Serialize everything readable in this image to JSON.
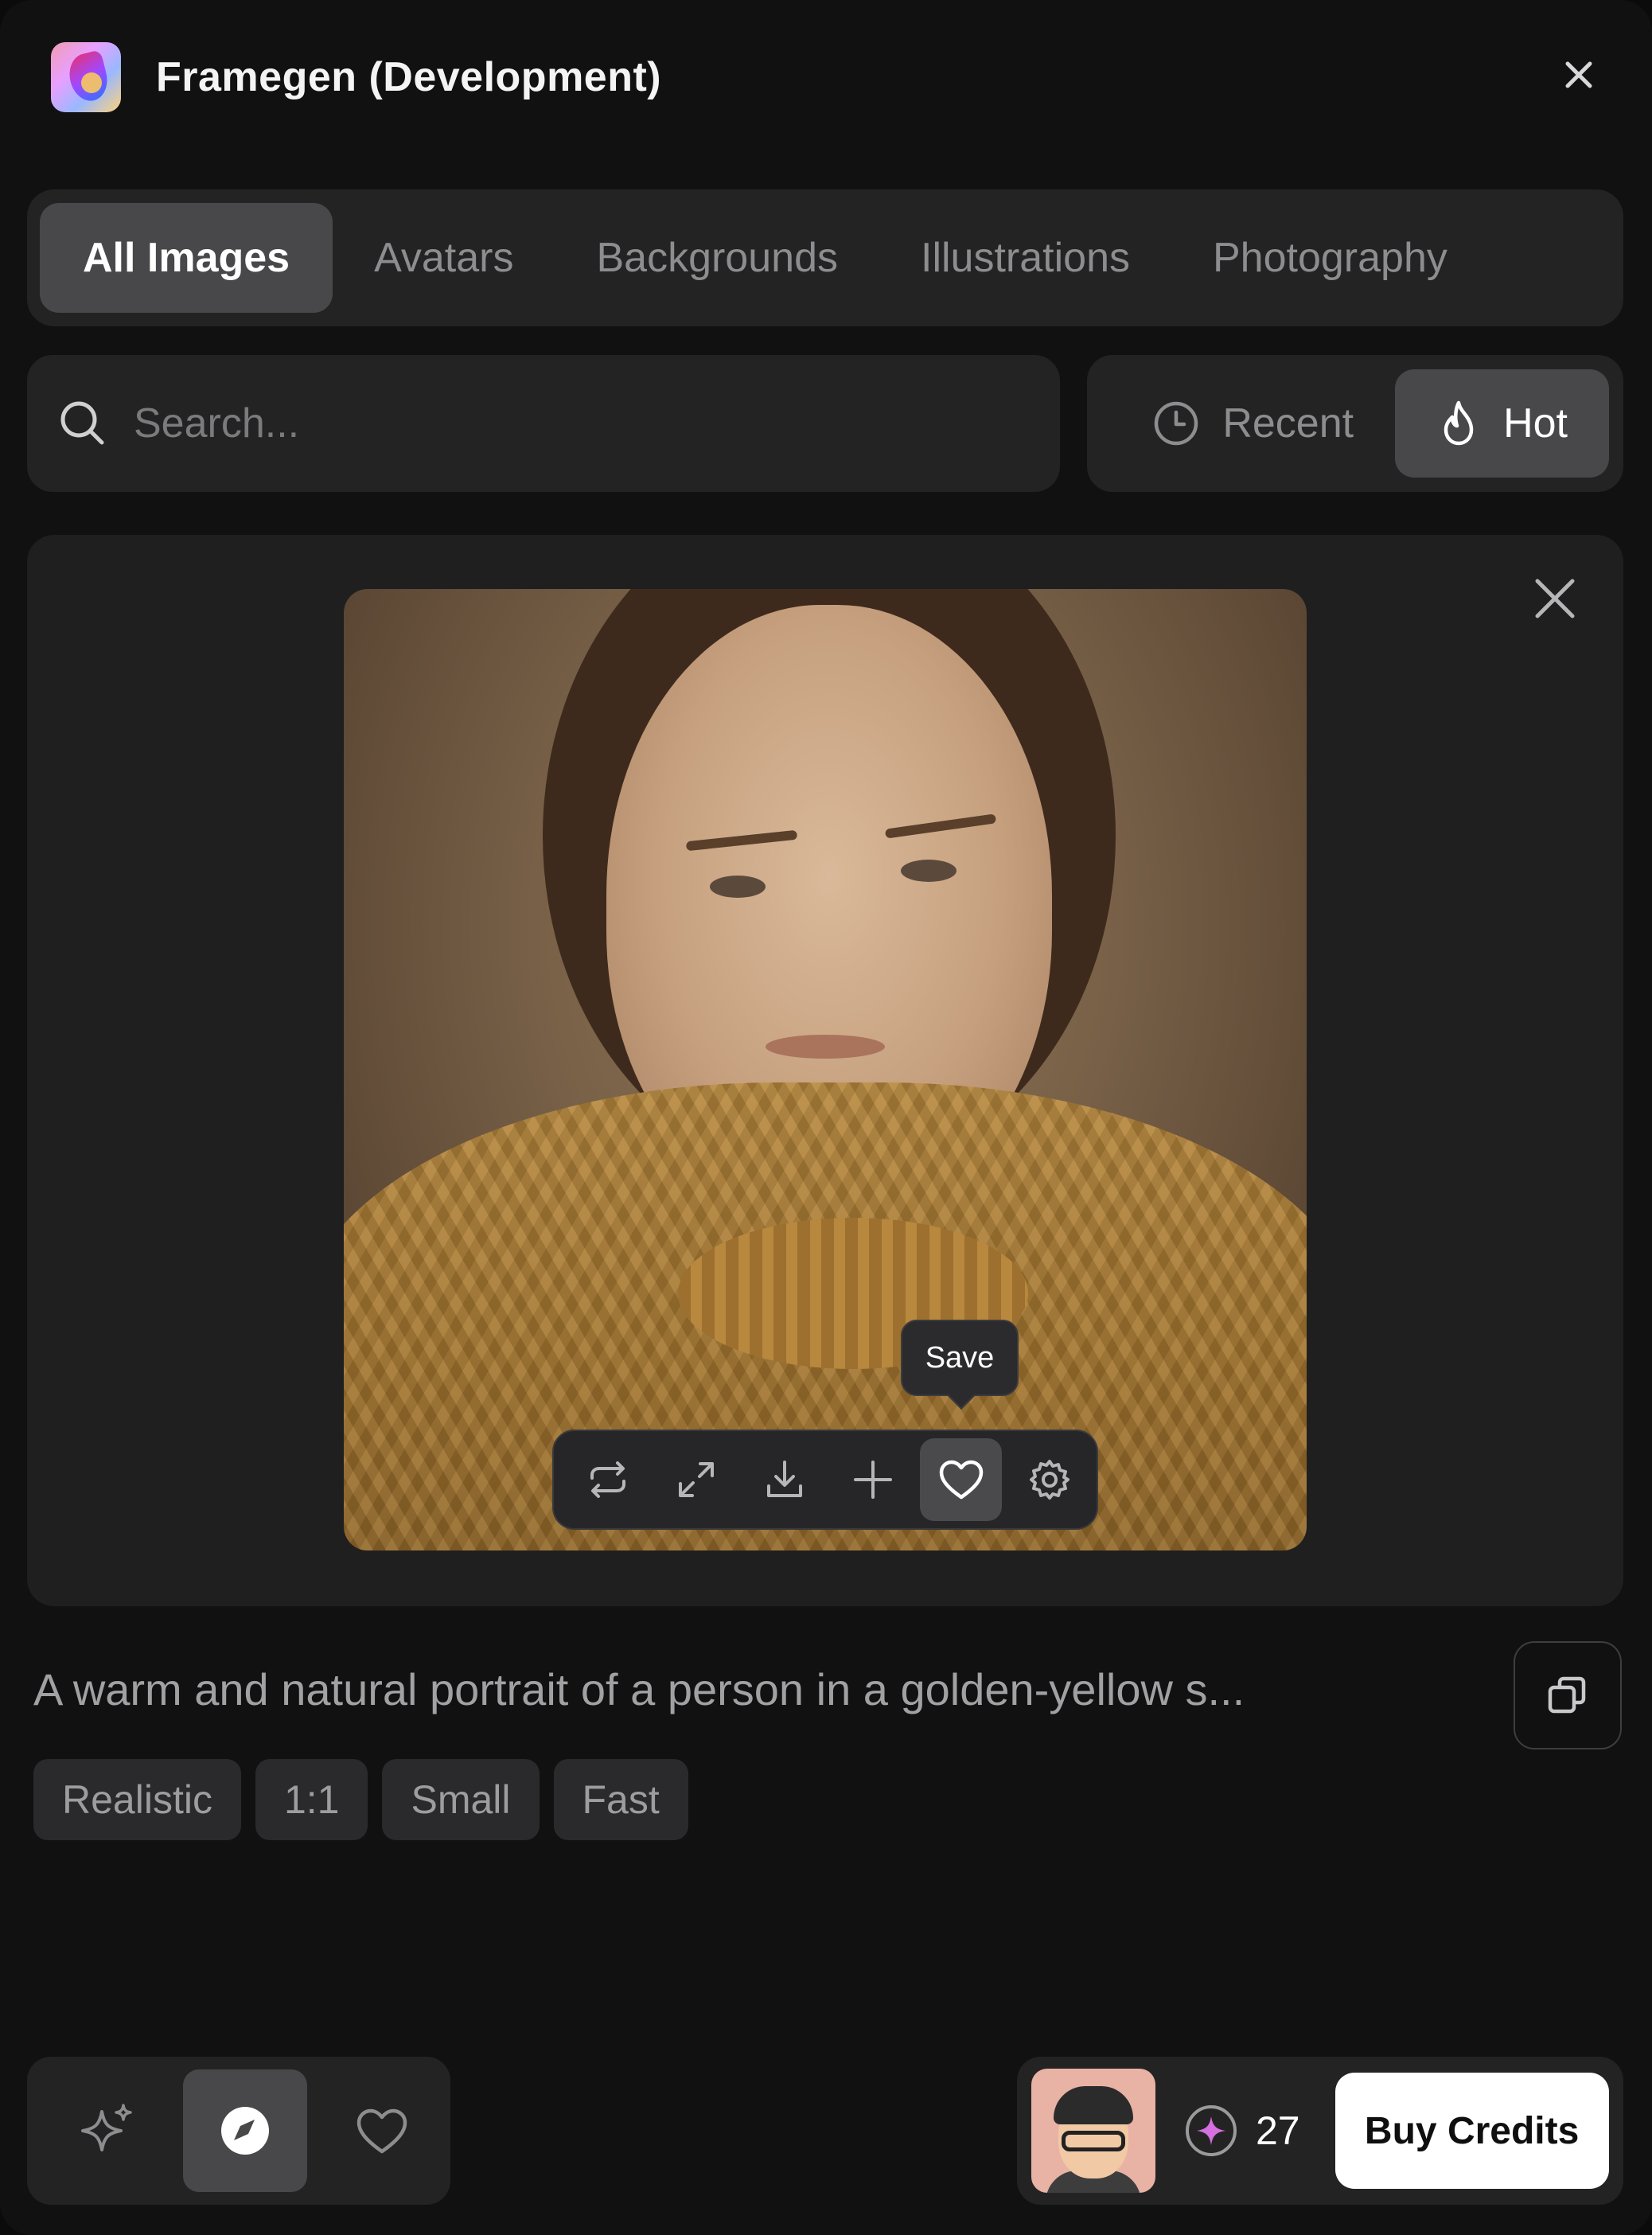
{
  "app": {
    "title": "Framegen (Development)"
  },
  "tabs": [
    {
      "label": "All Images",
      "active": true
    },
    {
      "label": "Avatars",
      "active": false
    },
    {
      "label": "Backgrounds",
      "active": false
    },
    {
      "label": "Illustrations",
      "active": false
    },
    {
      "label": "Photography",
      "active": false
    }
  ],
  "search": {
    "placeholder": "Search...",
    "value": ""
  },
  "sort": {
    "recent_label": "Recent",
    "hot_label": "Hot",
    "selected": "Hot"
  },
  "preview": {
    "tooltip": "Save",
    "tools": [
      "repeat-icon",
      "expand-icon",
      "download-icon",
      "plus-icon",
      "heart-icon",
      "gear-icon"
    ],
    "active_tool": "heart-icon"
  },
  "prompt": {
    "text": "A warm and natural portrait of a person in a golden-yellow s...",
    "tags": [
      "Realistic",
      "1:1",
      "Small",
      "Fast"
    ]
  },
  "bottom_nav": {
    "items": [
      "sparkles-icon",
      "compass-icon",
      "heart-icon"
    ],
    "active": "compass-icon"
  },
  "account": {
    "credits": "27",
    "buy_label": "Buy Credits"
  },
  "colors": {
    "background": "#111112",
    "panel": "#232324",
    "active": "#48484a",
    "accent_button": "#ffffff"
  }
}
